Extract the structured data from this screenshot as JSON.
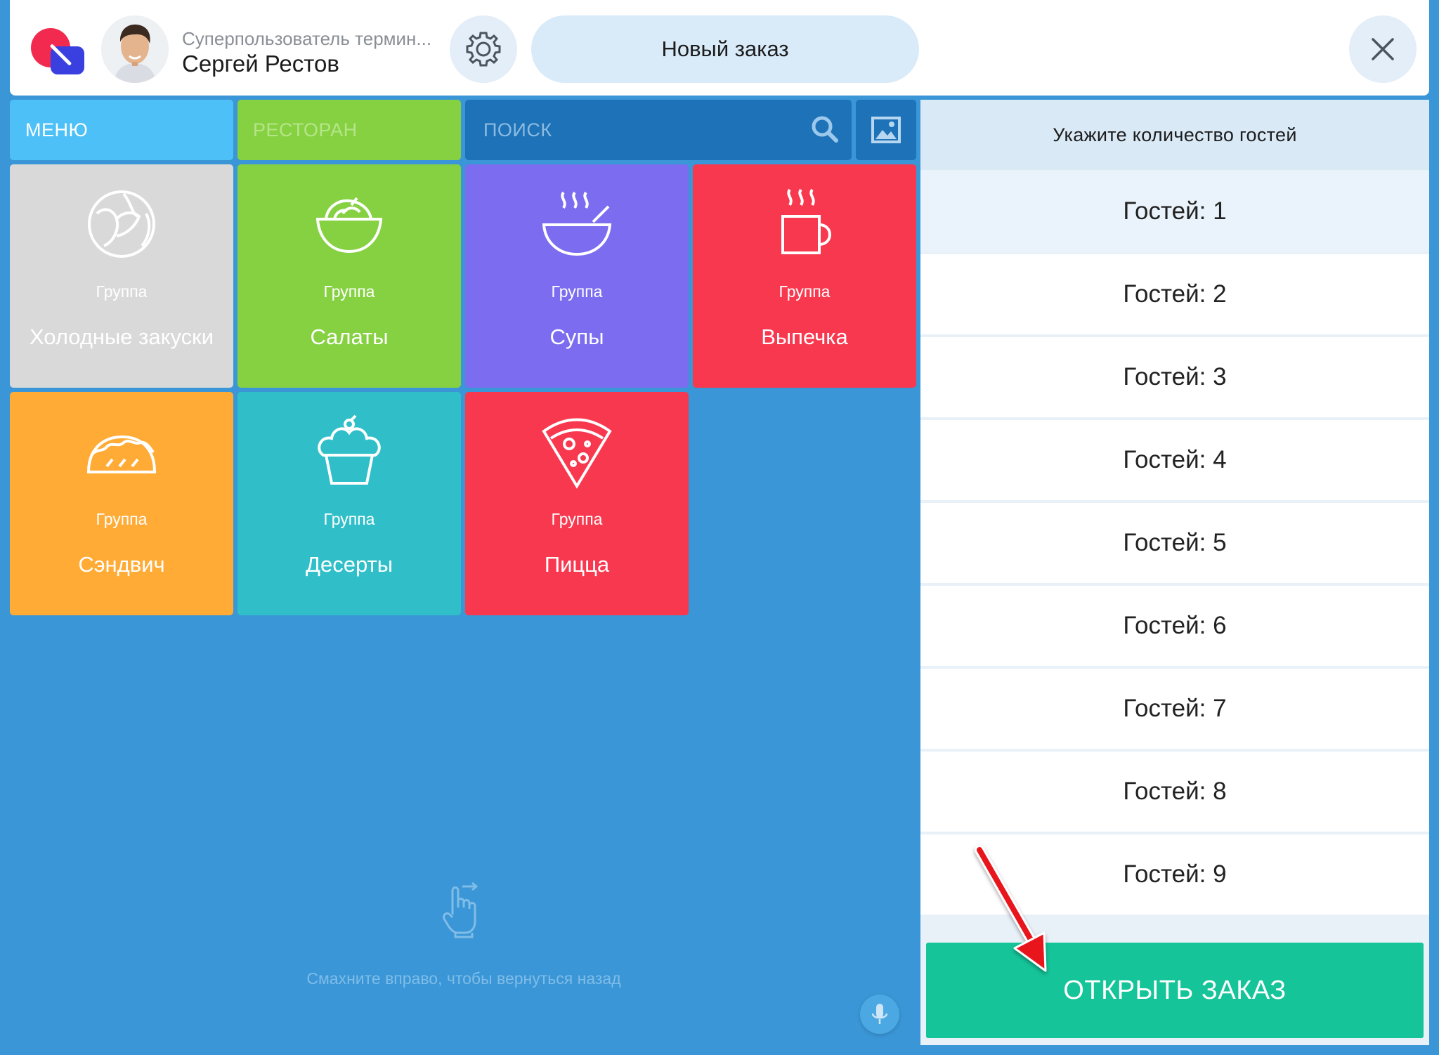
{
  "header": {
    "user_role": "Суперпользователь термин...",
    "user_name": "Сергей Рестов",
    "new_order_label": "Новый заказ"
  },
  "tabs": {
    "menu": "МЕНЮ",
    "restaurant": "РЕСТОРАН"
  },
  "search": {
    "placeholder": "ПОИСК"
  },
  "tiles": [
    {
      "group": "Группа",
      "name": "Холодные закуски",
      "color": "#d9d9d9",
      "icon": "cabbage-icon"
    },
    {
      "group": "Группа",
      "name": "Салаты",
      "color": "#86d142",
      "icon": "salad-bowl-icon"
    },
    {
      "group": "Группа",
      "name": "Супы",
      "color": "#7b6cf0",
      "icon": "soup-bowl-icon"
    },
    {
      "group": "Группа",
      "name": "Выпечка",
      "color": "#f8384f",
      "icon": "coffee-cup-icon"
    },
    {
      "group": "Группа",
      "name": "Сэндвич",
      "color": "#ffab35",
      "icon": "taco-icon"
    },
    {
      "group": "Группа",
      "name": "Десерты",
      "color": "#30bfc9",
      "icon": "cupcake-icon"
    },
    {
      "group": "Группа",
      "name": "Пицца",
      "color": "#f8384f",
      "icon": "pizza-icon"
    }
  ],
  "swipe_hint": "Смахните вправо, чтобы вернуться назад",
  "panel": {
    "title": "Укажите количество гостей",
    "guests": [
      "Гостей: 1",
      "Гостей: 2",
      "Гостей: 3",
      "Гостей: 4",
      "Гостей: 5",
      "Гостей: 6",
      "Гостей: 7",
      "Гостей: 8",
      "Гостей: 9"
    ],
    "selected_index": 0,
    "open_button": "ОТКРЫТЬ ЗАКАЗ"
  },
  "colors": {
    "background": "#3a96d6",
    "accent_green": "#15c499",
    "arrow_red": "#e8151f"
  }
}
